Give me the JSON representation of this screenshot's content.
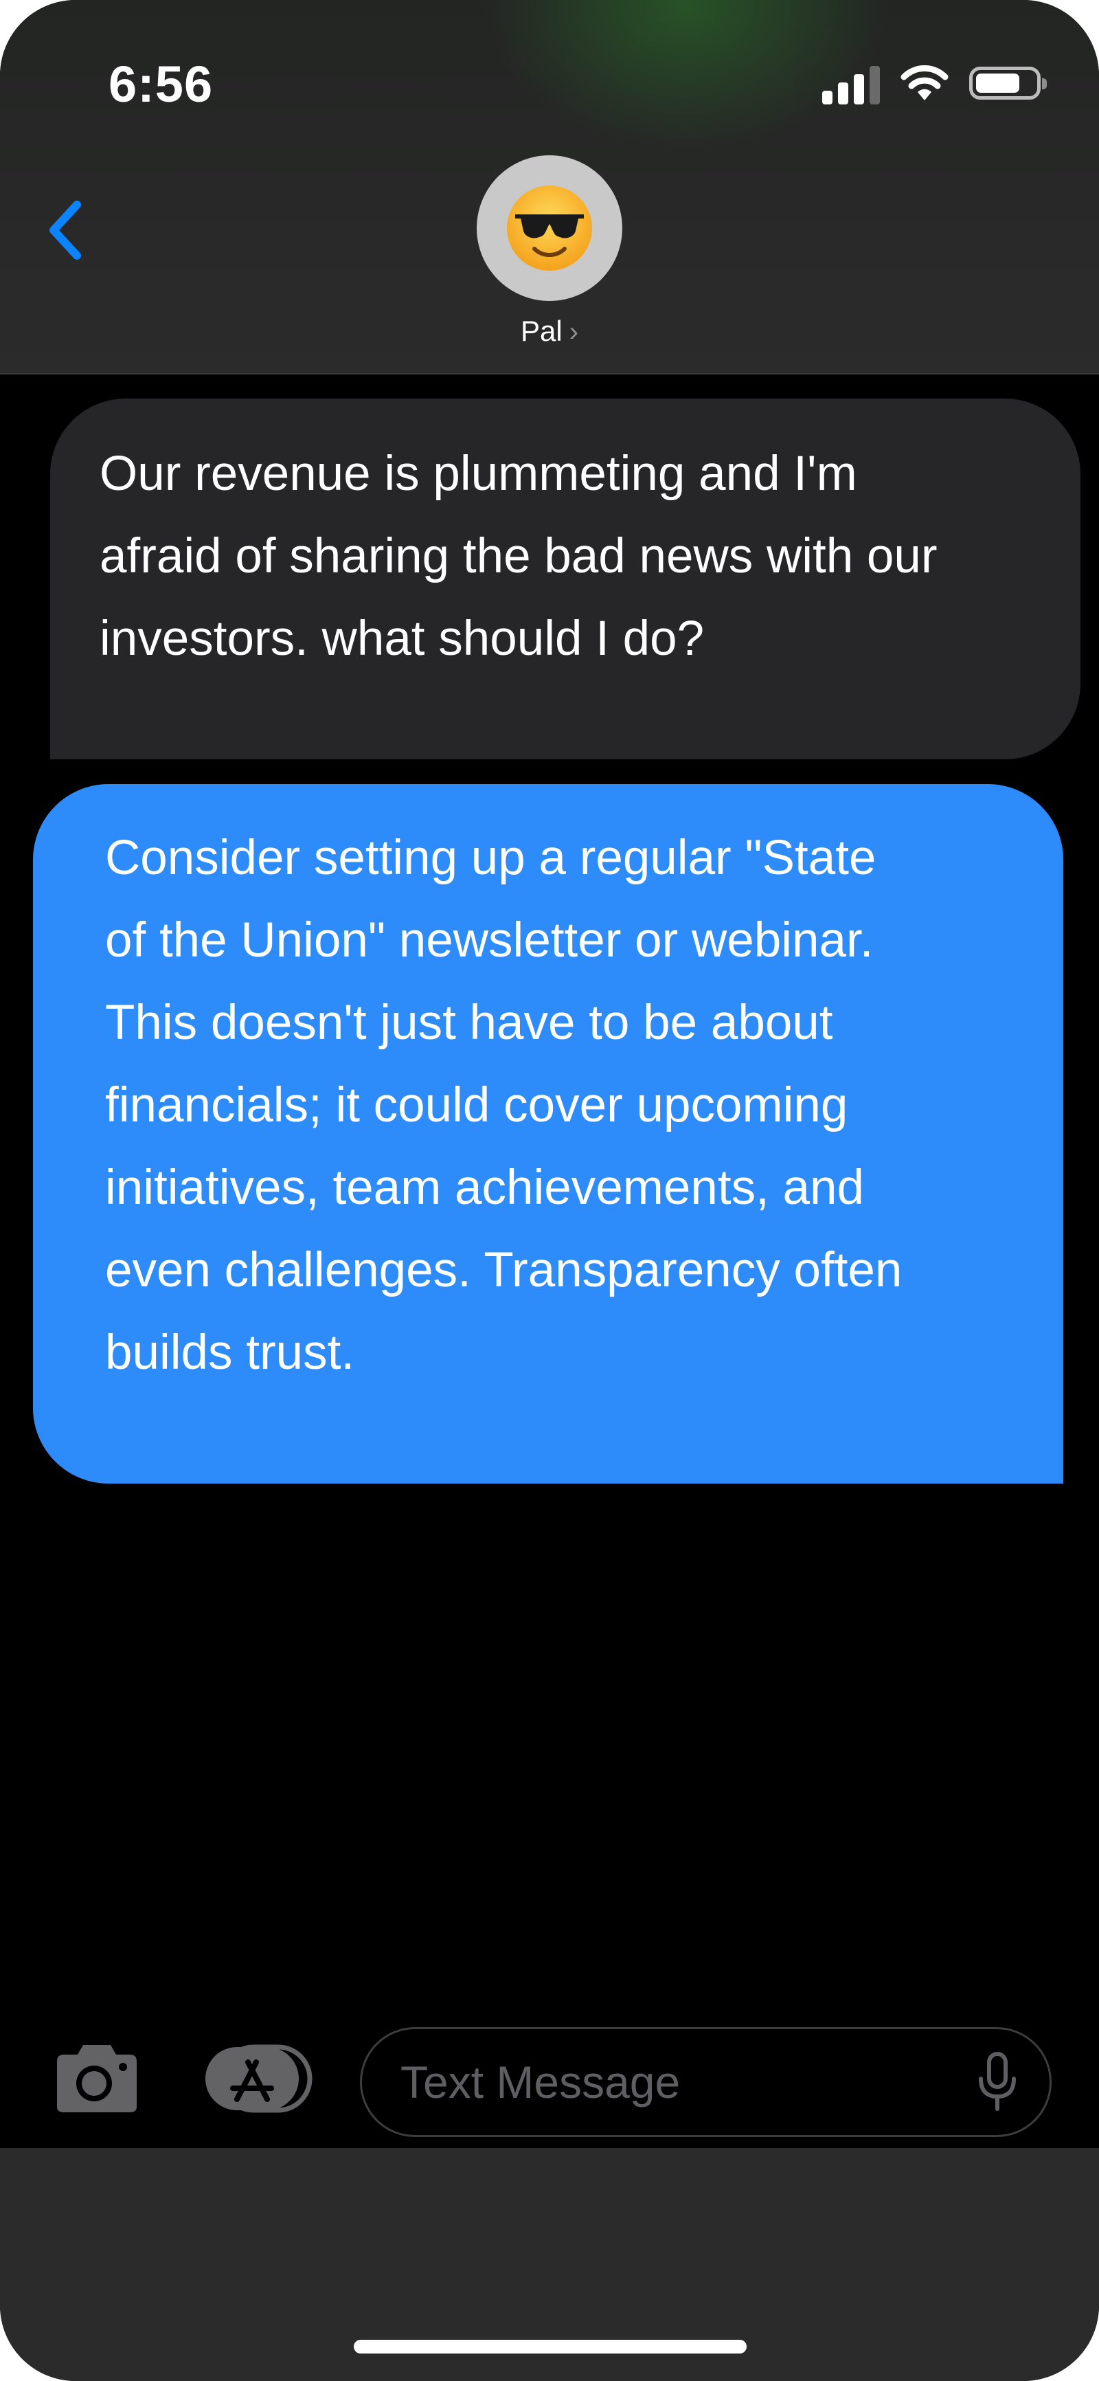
{
  "status_bar": {
    "time": "6:56",
    "battery_level": 0.75
  },
  "header": {
    "contact_name": "Pal",
    "contact_chevron": "›",
    "avatar_emoji": "😎"
  },
  "messages": [
    {
      "direction": "received",
      "text": "Our revenue is plummeting and I'm afraid of sharing the bad news with our investors. what should I do?",
      "lines": [
        "Our revenue is plummeting and I'm",
        "afraid of sharing the bad news with our",
        "investors. what should I do?"
      ]
    },
    {
      "direction": "sent",
      "text": "Consider setting up a regular \"State of the Union\" newsletter or webinar. This doesn't just have to be about financials; it could cover upcoming initiatives, team achievements, and even challenges. Transparency often builds trust.",
      "lines": [
        "Consider setting up a regular \"State",
        "of the Union\" newsletter or webinar.",
        "This doesn't just have to be about",
        "financials; it could cover upcoming",
        "initiatives, team achievements, and",
        "even challenges. Transparency often",
        "builds trust."
      ]
    }
  ],
  "compose": {
    "placeholder": "Text Message",
    "value": ""
  },
  "icons": {
    "back": "chevron-left-icon",
    "camera": "camera-icon",
    "apps": "app-store-icon",
    "mic": "microphone-icon",
    "signal": "cellular-signal-icon",
    "wifi": "wifi-icon",
    "battery": "battery-icon"
  },
  "colors": {
    "accent": "#0a84ff",
    "sent_bubble": "#2e8bfa",
    "received_bubble": "#262628",
    "background": "#000000"
  }
}
